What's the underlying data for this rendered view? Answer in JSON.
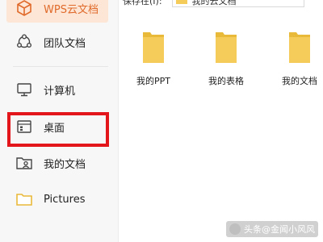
{
  "sidebar": {
    "items": [
      {
        "label": "WPS云文档",
        "icon": "cube-icon",
        "active": true
      },
      {
        "label": "团队文档",
        "icon": "team-share-icon"
      },
      {
        "label": "计算机",
        "icon": "computer-icon"
      },
      {
        "label": "桌面",
        "icon": "desktop-icon",
        "highlighted": true
      },
      {
        "label": "我的文档",
        "icon": "my-documents-icon"
      },
      {
        "label": "Pictures",
        "icon": "folder-icon"
      }
    ]
  },
  "path_bar": {
    "label": "保存在(I):",
    "location": "我的云文档"
  },
  "files": [
    {
      "name": "我的PPT",
      "icon": "folder-icon"
    },
    {
      "name": "我的表格",
      "icon": "folder-icon"
    },
    {
      "name": "我的文档",
      "icon": "folder-icon"
    }
  ],
  "watermark": {
    "text": "头条@金闻小风风"
  },
  "colors": {
    "accent": "#e06a2a",
    "active_bg": "#fde6d6",
    "highlight_border": "#e3161b",
    "folder": "#f5cc5a"
  }
}
